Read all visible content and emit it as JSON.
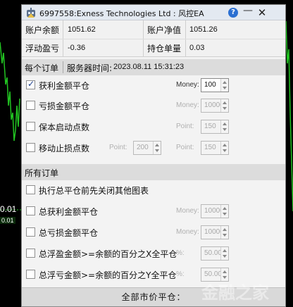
{
  "window": {
    "title": "6997558:Exness Technologies Ltd : 风控EA",
    "help_label": "?",
    "minimize_label": "—",
    "close_label": "✕"
  },
  "account": {
    "balance_label": "账户余额",
    "balance_value": "1051.62",
    "equity_label": "账户净值",
    "equity_value": "1051.26",
    "floating_label": "浮动盈亏",
    "floating_value": "-0.36",
    "position_label": "持仓单量",
    "position_value": "0.03"
  },
  "per_order": {
    "header": "每个订单",
    "server_time_label": "服务器时间:",
    "server_time_value": "2023.08.11 15:31:23",
    "rows": [
      {
        "label": "获利金额平仓",
        "checked": true,
        "field1_label": "Money:",
        "field1_value": "100"
      },
      {
        "label": "亏损金额平仓",
        "checked": false,
        "field1_label": "Money:",
        "field1_value": "10000"
      },
      {
        "label": "保本启动点数",
        "checked": false,
        "field1_label": "Point:",
        "field1_value": "150"
      },
      {
        "label": "移动止损点数",
        "checked": false,
        "field0_label": "Point:",
        "field0_value": "200",
        "field1_label": "Point:",
        "field1_value": "150"
      }
    ]
  },
  "all_orders": {
    "header": "所有订单",
    "rows": [
      {
        "label": "执行总平仓前先关闭其他图表",
        "checked": false
      },
      {
        "label": "总获利金额平仓",
        "checked": false,
        "field1_label": "Money:",
        "field1_value": "10000"
      },
      {
        "label": "总亏损金额平仓",
        "checked": false,
        "field1_label": "Money:",
        "field1_value": "10000"
      },
      {
        "label": "总浮盈金额>=余额的百分之X全平仓",
        "checked": false,
        "field1_label": "%:",
        "field1_value": "50.00"
      },
      {
        "label": "总浮亏金额>=余额的百分之Y全平仓",
        "checked": false,
        "field1_label": "%:",
        "field1_value": "50.00"
      }
    ],
    "close_all_label": "全部市价平仓："
  },
  "chart": {
    "price_big": "0.01",
    "price_small": "0.01"
  },
  "watermark": "金融之家",
  "colors": {
    "title_bar": "#e3e9f1",
    "section_bg": "#dcdcdc",
    "chart_green": "#22c522",
    "help_blue": "#2a6fd2"
  }
}
